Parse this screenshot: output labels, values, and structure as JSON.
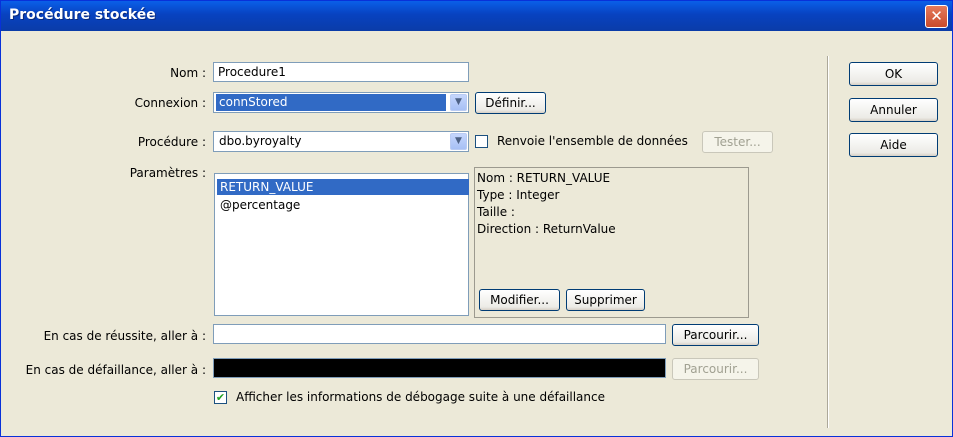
{
  "window": {
    "title": "Procédure stockée",
    "close_glyph": "✕"
  },
  "form": {
    "nom_label": "Nom :",
    "nom_value": "Procedure1",
    "connexion_label": "Connexion :",
    "connexion_value": "connStored",
    "definir_label": "Définir...",
    "procedure_label": "Procédure :",
    "procedure_value": "dbo.byroyalty",
    "renvoie_label": "Renvoie l'ensemble de données",
    "renvoie_checked": false,
    "tester_label": "Tester...",
    "parametres_label": "Paramètres :",
    "parameters": [
      "RETURN_VALUE",
      "@percentage"
    ],
    "selected_parameter": "RETURN_VALUE",
    "details": {
      "nom": "Nom : RETURN_VALUE",
      "type": "Type : Integer",
      "taille": "Taille :",
      "direction": "Direction : ReturnValue"
    },
    "modifier_label": "Modifier...",
    "supprimer_label": "Supprimer",
    "success_label": "En cas de réussite, aller à :",
    "success_value": "",
    "parcourir1_label": "Parcourir...",
    "failure_label": "En cas de défaillance, aller à :",
    "failure_value": "",
    "parcourir2_label": "Parcourir...",
    "debug_label": "Afficher les informations de débogage suite à une défaillance",
    "debug_checked": true
  },
  "buttons": {
    "ok": "OK",
    "annuler": "Annuler",
    "aide": "Aide"
  },
  "icons": {
    "combo_arrow": "chevron-down-icon",
    "check": "checkmark-icon"
  },
  "colors": {
    "title_bar": "#0842c0",
    "selection": "#316ac5",
    "dialog_bg": "#ece9d8",
    "failure_field": "#000000"
  }
}
